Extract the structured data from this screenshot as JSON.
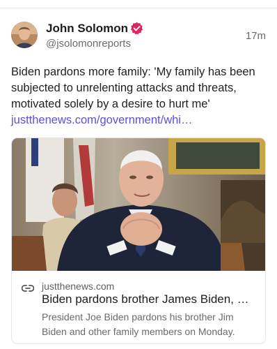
{
  "post": {
    "author_name": "John Solomon",
    "handle": "@jsolomonreports",
    "time": "17m",
    "text": "Biden pardons more family: 'My family has been subjected to unrelenting attacks and threats, motivated solely by a desire to hurt me' ",
    "link_text": "justthenews.com/government/whi…"
  },
  "card": {
    "domain": "justthenews.com",
    "title": "Biden pardons brother James Biden, …",
    "description": "President Joe Biden pardons his brother Jim Biden and other family members on Monday."
  },
  "colors": {
    "accent": "#5b4fe0",
    "verified_badge": "#e0245e"
  },
  "icons": {
    "verified": "verified-badge-icon",
    "link": "link-icon"
  }
}
